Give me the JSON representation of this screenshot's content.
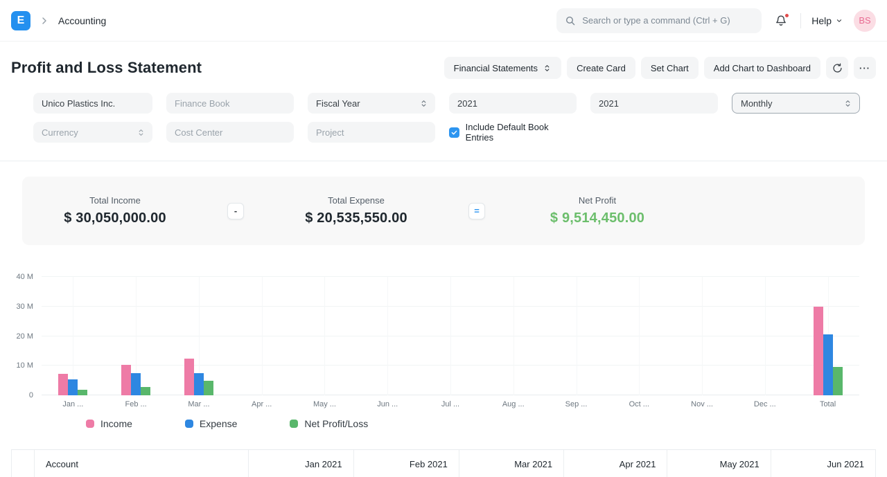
{
  "colors": {
    "accent_blue": "#2490EF",
    "checkbox_blue": "#2D95F0",
    "notification_dot": "#E24C4C",
    "net_profit_text": "#6CBE6C",
    "bar_income": "#EE7BA6",
    "bar_expense": "#2E87E1",
    "bar_net": "#59B76B"
  },
  "navbar": {
    "logo_letter": "E",
    "breadcrumb": "Accounting",
    "search_placeholder": "Search or type a command (Ctrl + G)",
    "help_label": "Help",
    "avatar_initials": "BS"
  },
  "page": {
    "title": "Profit and Loss Statement",
    "actions": {
      "report_select": "Financial Statements",
      "create_card": "Create Card",
      "set_chart": "Set Chart",
      "add_chart_to_dashboard": "Add Chart to Dashboard",
      "ellipsis": "···"
    }
  },
  "filters": {
    "company_value": "Unico Plastics Inc.",
    "finance_book_placeholder": "Finance Book",
    "period_basis_value": "Fiscal Year",
    "from_fiscal_year_value": "2021",
    "to_fiscal_year_value": "2021",
    "periodicity_value": "Monthly",
    "currency_value": "Currency",
    "cost_center_placeholder": "Cost Center",
    "project_placeholder": "Project",
    "include_default_book_entries_label": "Include Default Book Entries",
    "include_default_book_entries_checked": true
  },
  "summary": {
    "income_label": "Total Income",
    "income_value": "$ 30,050,000.00",
    "minus_symbol": "-",
    "expense_label": "Total Expense",
    "expense_value": "$ 20,535,550.00",
    "equals_symbol": "=",
    "net_label": "Net Profit",
    "net_value": "$ 9,514,450.00"
  },
  "chart_data": {
    "type": "bar",
    "title": "",
    "categories": [
      "Jan ...",
      "Feb ...",
      "Mar ...",
      "Apr ...",
      "May ...",
      "Jun ...",
      "Jul ...",
      "Aug ...",
      "Sep ...",
      "Oct ...",
      "Nov ...",
      "Dec ...",
      "Total"
    ],
    "series": [
      {
        "name": "Income",
        "color": "#EE7BA6",
        "values": [
          7300000,
          10300000,
          12450000,
          0,
          0,
          0,
          0,
          0,
          0,
          0,
          0,
          0,
          30050000
        ]
      },
      {
        "name": "Expense",
        "color": "#2E87E1",
        "values": [
          5500000,
          7500000,
          7535550,
          0,
          0,
          0,
          0,
          0,
          0,
          0,
          0,
          0,
          20535550
        ]
      },
      {
        "name": "Net Profit/Loss",
        "color": "#59B76B",
        "values": [
          1800000,
          2800000,
          4914450,
          0,
          0,
          0,
          0,
          0,
          0,
          0,
          0,
          0,
          9514450
        ]
      }
    ],
    "ylim": [
      0,
      40000000
    ],
    "yticks": [
      {
        "value": 0,
        "label": "0"
      },
      {
        "value": 10000000,
        "label": "10 M"
      },
      {
        "value": 20000000,
        "label": "20 M"
      },
      {
        "value": 30000000,
        "label": "30 M"
      },
      {
        "value": 40000000,
        "label": "40 M"
      }
    ],
    "grid": true,
    "legend_position": "bottom"
  },
  "table": {
    "columns": [
      "",
      "Account",
      "Jan 2021",
      "Feb 2021",
      "Mar 2021",
      "Apr 2021",
      "May 2021",
      "Jun 2021"
    ]
  }
}
